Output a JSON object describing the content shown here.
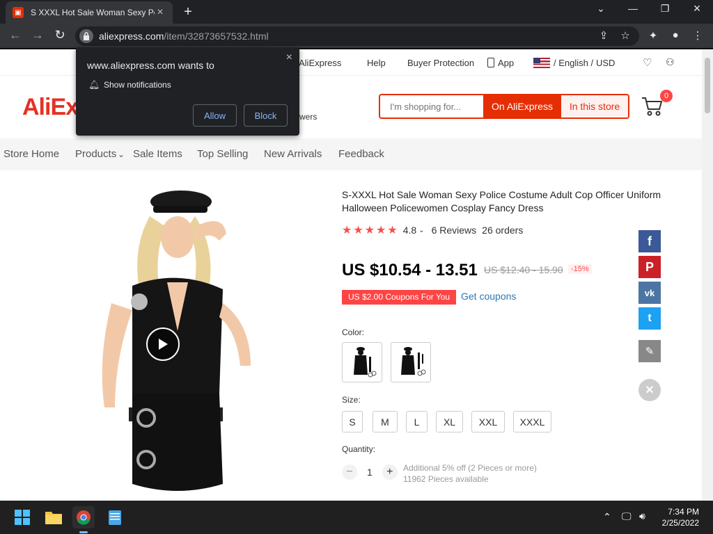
{
  "browser": {
    "tab_title": "S XXXL Hot Sale Woman Sexy Po",
    "url_domain": "aliexpress.com",
    "url_path": "/item/32873657532.html"
  },
  "popup": {
    "message": "www.aliexpress.com wants to",
    "permission": "Show notifications",
    "allow_label": "Allow",
    "block_label": "Block"
  },
  "topnav": {
    "aliexpress": "AliExpress",
    "help": "Help",
    "buyer_protection": "Buyer Protection",
    "app": "App",
    "language": "/ English /",
    "currency": "USD"
  },
  "header": {
    "logo": "AliEx",
    "followers_suffix": "wers",
    "search_placeholder": "I'm shopping for...",
    "on_aliexpress": "On AliExpress",
    "in_this_store": "In this store",
    "cart_count": "0"
  },
  "storenav": {
    "items": [
      "Store Home",
      "Products",
      "Sale Items",
      "Top Selling",
      "New Arrivals",
      "Feedback"
    ]
  },
  "product": {
    "title": "S-XXXL Hot Sale Woman Sexy Police Costume Adult Cop Officer Uniform Halloween Policewomen Cosplay Fancy Dress",
    "rating": "4.8",
    "rating_value": 4.8,
    "reviews": "6 Reviews",
    "orders": "26 orders",
    "price": "US $10.54 - 13.51",
    "old_price": "US $12.40 - 15.90",
    "discount": "-15%",
    "coupon": "US $2.00 Coupons For You",
    "get_coupons": "Get coupons",
    "color_label": "Color:",
    "size_label": "Size:",
    "sizes": [
      "S",
      "M",
      "L",
      "XL",
      "XXL",
      "XXXL"
    ],
    "quantity_label": "Quantity:",
    "quantity": "1",
    "qty_minus": "−",
    "qty_plus": "+",
    "qty_discount": "Additional 5% off (2 Pieces or more)",
    "available": "11962 Pieces available"
  },
  "colors": {
    "accent": "#e62e04",
    "link": "#2a7ab0"
  },
  "taskbar": {
    "time": "7:34 PM",
    "date": "2/25/2022"
  }
}
